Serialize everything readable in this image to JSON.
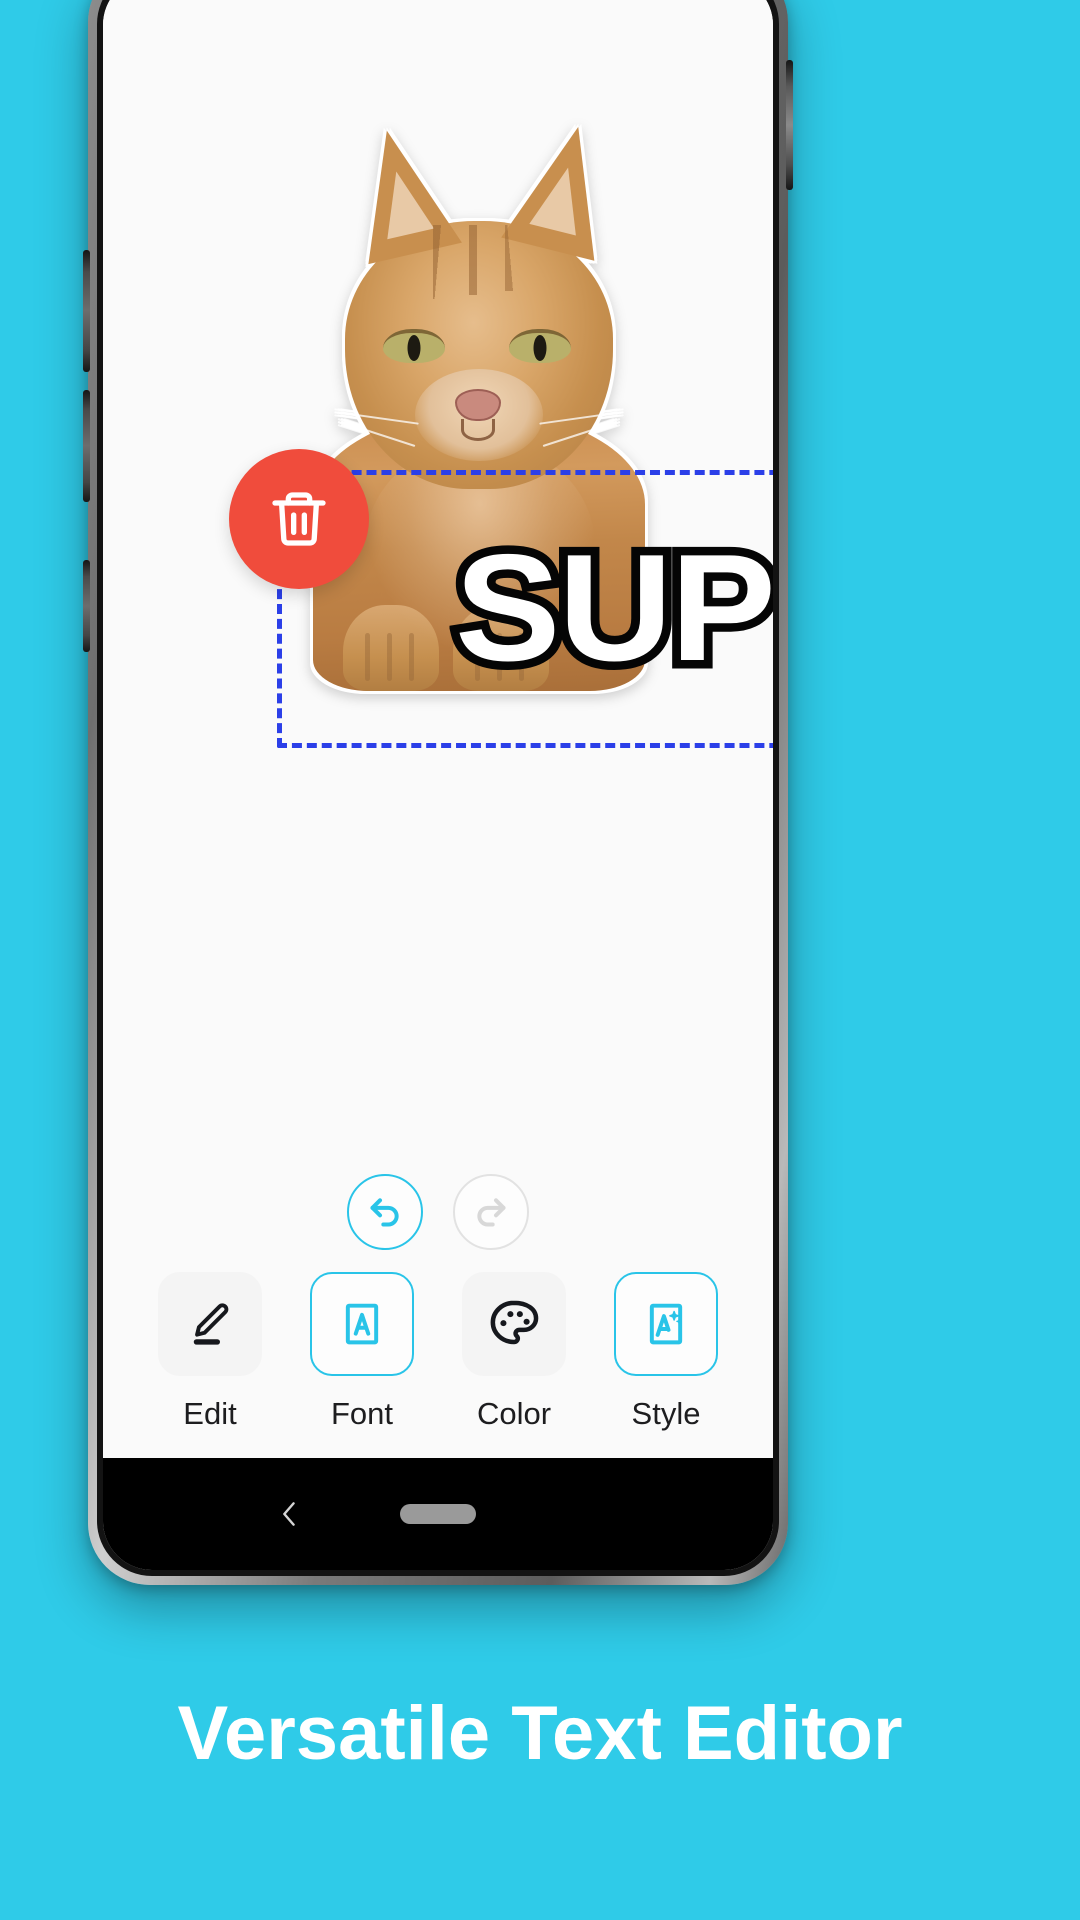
{
  "theme": {
    "background_color": "#2FCBE8",
    "accent_color": "#29C4E8",
    "delete_color": "#F04C3C",
    "selection_color": "#2B3FE8",
    "screen_color": "#FAFAFA"
  },
  "caption": {
    "text": "Versatile Text Editor"
  },
  "canvas": {
    "sticker_name": "orange-tabby-cat-sticker",
    "overlay_text": "SUP",
    "overlay_text_fill": "#FFFFFF",
    "overlay_text_stroke": "#050505",
    "selection_active": true,
    "delete_button_label": "Delete"
  },
  "history": {
    "undo_label": "Undo",
    "undo_enabled": true,
    "redo_label": "Redo",
    "redo_enabled": false
  },
  "toolbar": {
    "items": [
      {
        "label": "Edit",
        "icon": "pencil-underline-icon",
        "active": false
      },
      {
        "label": "Font",
        "icon": "letter-a-box-icon",
        "active": true
      },
      {
        "label": "Color",
        "icon": "palette-icon",
        "active": false
      },
      {
        "label": "Style",
        "icon": "letter-a-sparkle-icon",
        "active": true
      }
    ]
  },
  "navbar": {
    "back_label": "Back",
    "home_label": "Home"
  }
}
